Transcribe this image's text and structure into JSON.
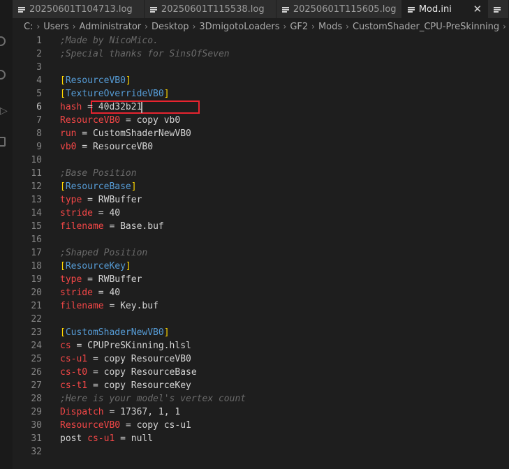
{
  "tabs": [
    {
      "label": "20250601T104713.log",
      "active": false
    },
    {
      "label": "20250601T115538.log",
      "active": false
    },
    {
      "label": "20250601T115605.log",
      "active": false
    },
    {
      "label": "Mod.ini",
      "active": true,
      "close": "✕"
    },
    {
      "label": "",
      "active": false
    }
  ],
  "breadcrumb": {
    "parts": [
      "C:",
      "Users",
      "Administrator",
      "Desktop",
      "3DmigotoLoaders",
      "GF2",
      "Mods",
      "CustomShader_CPU-PreSkinning",
      "Mod.ini"
    ],
    "separator": "›"
  },
  "editor": {
    "current_line": 6,
    "highlighted_value": "40d32b21",
    "lines": [
      [
        {
          "t": ";Made by NicoMico.",
          "c": "comment"
        }
      ],
      [
        {
          "t": ";Special thanks for SinsOfSeven",
          "c": "comment"
        }
      ],
      [],
      [
        {
          "t": "[",
          "c": "brk"
        },
        {
          "t": "ResourceVB0",
          "c": "sec"
        },
        {
          "t": "]",
          "c": "brk"
        }
      ],
      [
        {
          "t": "[",
          "c": "brk"
        },
        {
          "t": "TextureOverrideVB0",
          "c": "sec"
        },
        {
          "t": "]",
          "c": "brk"
        }
      ],
      [
        {
          "t": "hash",
          "c": "key"
        },
        {
          "t": " = ",
          "c": "op"
        },
        {
          "t": "40d32b21",
          "c": "val"
        }
      ],
      [
        {
          "t": "ResourceVB0",
          "c": "key"
        },
        {
          "t": " = ",
          "c": "op"
        },
        {
          "t": "copy vb0",
          "c": "val"
        }
      ],
      [
        {
          "t": "run",
          "c": "key"
        },
        {
          "t": " = ",
          "c": "op"
        },
        {
          "t": "CustomShaderNewVB0",
          "c": "val"
        }
      ],
      [
        {
          "t": "vb0",
          "c": "key"
        },
        {
          "t": " = ",
          "c": "op"
        },
        {
          "t": "ResourceVB0",
          "c": "val"
        }
      ],
      [],
      [
        {
          "t": ";Base Position",
          "c": "comment"
        }
      ],
      [
        {
          "t": "[",
          "c": "brk"
        },
        {
          "t": "ResourceBase",
          "c": "sec"
        },
        {
          "t": "]",
          "c": "brk"
        }
      ],
      [
        {
          "t": "type",
          "c": "key"
        },
        {
          "t": " = ",
          "c": "op"
        },
        {
          "t": "RWBuffer",
          "c": "val"
        }
      ],
      [
        {
          "t": "stride",
          "c": "key"
        },
        {
          "t": " = ",
          "c": "op"
        },
        {
          "t": "40",
          "c": "val"
        }
      ],
      [
        {
          "t": "filename",
          "c": "key"
        },
        {
          "t": " = ",
          "c": "op"
        },
        {
          "t": "Base.buf",
          "c": "val"
        }
      ],
      [],
      [
        {
          "t": ";Shaped Position",
          "c": "comment"
        }
      ],
      [
        {
          "t": "[",
          "c": "brk"
        },
        {
          "t": "ResourceKey",
          "c": "sec"
        },
        {
          "t": "]",
          "c": "brk"
        }
      ],
      [
        {
          "t": "type",
          "c": "key"
        },
        {
          "t": " = ",
          "c": "op"
        },
        {
          "t": "RWBuffer",
          "c": "val"
        }
      ],
      [
        {
          "t": "stride",
          "c": "key"
        },
        {
          "t": " = ",
          "c": "op"
        },
        {
          "t": "40",
          "c": "val"
        }
      ],
      [
        {
          "t": "filename",
          "c": "key"
        },
        {
          "t": " = ",
          "c": "op"
        },
        {
          "t": "Key.buf",
          "c": "val"
        }
      ],
      [],
      [
        {
          "t": "[",
          "c": "brk"
        },
        {
          "t": "CustomShaderNewVB0",
          "c": "sec"
        },
        {
          "t": "]",
          "c": "brk"
        }
      ],
      [
        {
          "t": "cs",
          "c": "key"
        },
        {
          "t": " = ",
          "c": "op"
        },
        {
          "t": "CPUPreSKinning.hlsl",
          "c": "val"
        }
      ],
      [
        {
          "t": "cs-u1",
          "c": "key"
        },
        {
          "t": " = ",
          "c": "op"
        },
        {
          "t": "copy ResourceVB0",
          "c": "val"
        }
      ],
      [
        {
          "t": "cs-t0",
          "c": "key"
        },
        {
          "t": " = ",
          "c": "op"
        },
        {
          "t": "copy ResourceBase",
          "c": "val"
        }
      ],
      [
        {
          "t": "cs-t1",
          "c": "key"
        },
        {
          "t": " = ",
          "c": "op"
        },
        {
          "t": "copy ResourceKey",
          "c": "val"
        }
      ],
      [
        {
          "t": ";Here is your model's vertex count",
          "c": "comment"
        }
      ],
      [
        {
          "t": "Dispatch",
          "c": "key"
        },
        {
          "t": " = ",
          "c": "op"
        },
        {
          "t": "17367, 1, 1",
          "c": "val"
        }
      ],
      [
        {
          "t": "ResourceVB0",
          "c": "key"
        },
        {
          "t": " = ",
          "c": "op"
        },
        {
          "t": "copy cs-u1",
          "c": "val"
        }
      ],
      [
        {
          "t": "post ",
          "c": "val"
        },
        {
          "t": "cs-u1",
          "c": "key"
        },
        {
          "t": " = ",
          "c": "op"
        },
        {
          "t": "null",
          "c": "val"
        }
      ],
      []
    ]
  },
  "colors": {
    "background": "#1e1e1e",
    "section": "#569cd6",
    "bracket": "#ffd700",
    "key": "#f44747",
    "comment": "#6a6a6a",
    "highlight_box": "#e8242f"
  },
  "icons": [
    "file-lines-icon",
    "close-icon",
    "chevron-right-icon",
    "search-icon",
    "source-control-icon",
    "run-debug-icon",
    "extensions-icon"
  ]
}
